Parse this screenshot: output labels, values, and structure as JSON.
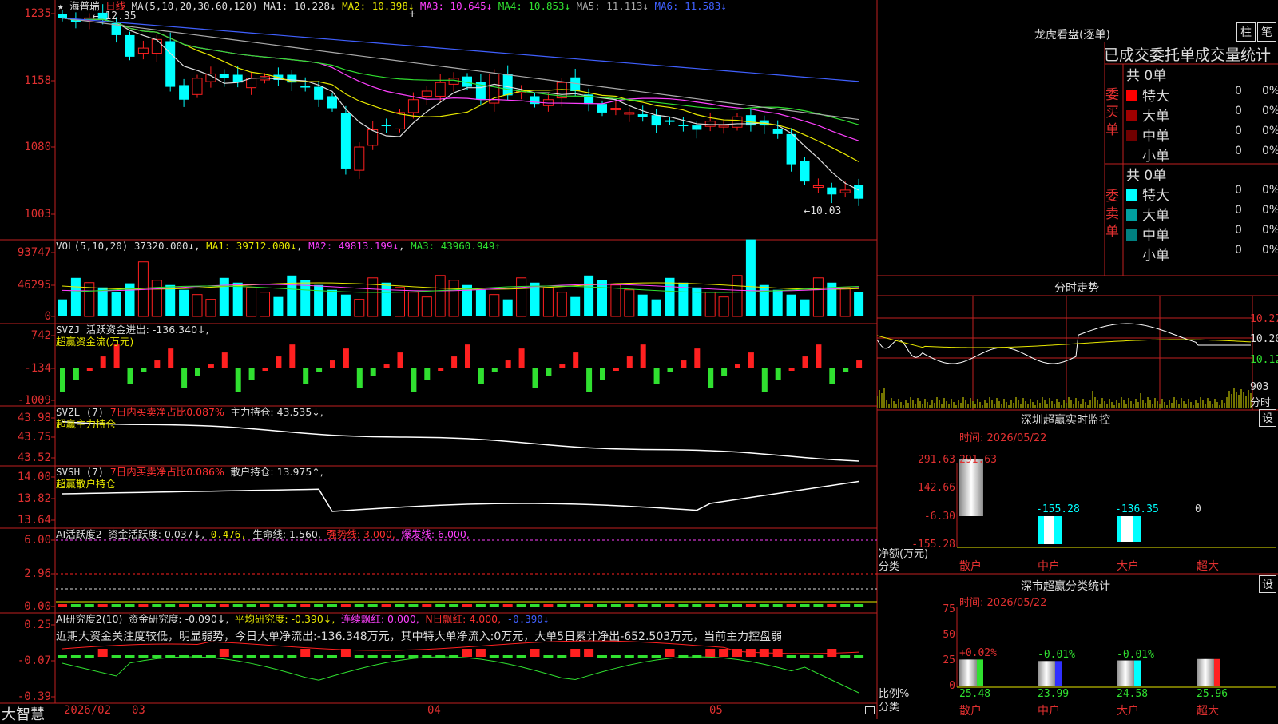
{
  "stock": {
    "name": "海普瑞",
    "period": "日线",
    "ma_label": "MA(5,10,20,30,60,120)",
    "ma": [
      {
        "label": "MA1:",
        "value": "10.228↓",
        "color": "#dddddd"
      },
      {
        "label": "MA2:",
        "value": "10.398↓",
        "color": "#e8e800"
      },
      {
        "label": "MA3:",
        "value": "10.645↓",
        "color": "#ff40ff"
      },
      {
        "label": "MA4:",
        "value": "10.853↓",
        "color": "#30e030"
      },
      {
        "label": "MA5:",
        "value": "11.113↓",
        "color": "#aaaaaa"
      },
      {
        "label": "MA6:",
        "value": "11.583↓",
        "color": "#4060ff"
      }
    ],
    "high_mark": "12.35",
    "low_mark": "10.03",
    "axis": [
      "1235",
      "1158",
      "1080",
      "1003"
    ]
  },
  "vol": {
    "label": "VOL(5,10,20)",
    "value": "37320.000↓",
    "ma1": "MA1: 39712.000↓",
    "ma2": "MA2: 49813.199↓",
    "ma3": "MA3: 43960.949↑",
    "axis": [
      "93747",
      "46295",
      "0"
    ]
  },
  "svzj": {
    "label": "SVZJ",
    "text": "活跃资金进出: -136.340↓,",
    "sub": "超赢资金流(万元)",
    "axis": [
      "742",
      "-134",
      "-1009"
    ]
  },
  "svzl": {
    "label": "SVZL (7)",
    "text1": "7日内买卖净占比0.087%",
    "text2": "主力持仓: 43.535↓,",
    "sub": "超赢主力持仓",
    "axis": [
      "43.98",
      "43.75",
      "43.52"
    ]
  },
  "svsh": {
    "label": "SVSH (7)",
    "text1": "7日内买卖净占比0.086%",
    "text2": "散户持仓: 13.975↑,",
    "sub": "超赢散户持仓",
    "axis": [
      "14.00",
      "13.82",
      "13.64"
    ]
  },
  "ai1": {
    "label": "AI活跃度2",
    "t1": "资金活跃度: 0.037↓,",
    "t2": "0.476,",
    "t3": "生命线: 1.560,",
    "t4": "强势线: 3.000,",
    "t5": "爆发线: 6.000,",
    "axis": [
      "6.00",
      "2.96",
      "0.00"
    ]
  },
  "ai2": {
    "label": "AI研究度2(10)",
    "t1": "资金研究度: -0.090↓,",
    "t2": "平均研究度: -0.390↓,",
    "t3": "连续飘红: 0.000,",
    "t4": "N日飘红: 4.000,",
    "t5": "-0.390↓",
    "comment": "近期大资金关注度较低，明显弱势，今日大单净流出:-136.348万元，其中特大单净流入:0万元，大单5日累计净出-652.503万元，当前主力控盘弱",
    "axis": [
      "0.25",
      "-0.07",
      "-0.39"
    ]
  },
  "bottom": {
    "brand": "大智慧",
    "date_start": "2026/02",
    "months": [
      "03",
      "04",
      "05"
    ]
  },
  "right": {
    "title": "龙虎看盘(逐单)",
    "btn1": "柱",
    "btn2": "笔",
    "table_title": "已成交委托单成交量统计",
    "buy_label": "委买单",
    "sell_label": "委卖单",
    "buy_total": "共 0单",
    "sell_total": "共 0单",
    "buy_rows": [
      {
        "name": "特大",
        "value": "0",
        "pct": "0%",
        "color": "#ff0000"
      },
      {
        "name": "大单",
        "value": "0",
        "pct": "0%",
        "color": "#a00000"
      },
      {
        "name": "中单",
        "value": "0",
        "pct": "0%",
        "color": "#700000"
      },
      {
        "name": "小单",
        "value": "0",
        "pct": "0%",
        "color": "#000000"
      }
    ],
    "sell_rows": [
      {
        "name": "特大",
        "value": "0",
        "pct": "0%",
        "color": "#00ffff"
      },
      {
        "name": "大单",
        "value": "0",
        "pct": "0%",
        "color": "#00a0a0"
      },
      {
        "name": "中单",
        "value": "0",
        "pct": "0%",
        "color": "#008080"
      },
      {
        "name": "小单",
        "value": "0",
        "pct": "0%",
        "color": "#000000"
      }
    ],
    "intraday_title": "分时走势",
    "intraday_axis": [
      "10.27",
      "10.20",
      "10.12"
    ],
    "intraday_vol": "903",
    "intraday_tag": "分时",
    "monitor_title": "深圳超赢实时监控",
    "settings": "设",
    "monitor_date": "时间: 2026/05/22",
    "monitor_axis": [
      "291.63",
      "142.66",
      "-6.30",
      "-155.28"
    ],
    "monitor_bars": [
      {
        "label": "散户",
        "value": "291.63"
      },
      {
        "label": "中户",
        "value": "-155.28"
      },
      {
        "label": "大户",
        "value": "-136.35"
      },
      {
        "label": "超大",
        "value": "0"
      }
    ],
    "monitor_unit": "净额(万元)",
    "monitor_cat": "分类",
    "class_title": "深市超赢分类统计",
    "class_date": "时间: 2026/05/22",
    "class_axis": [
      "75",
      "50",
      "25",
      "0"
    ],
    "class_bars": [
      {
        "label": "散户",
        "change": "+0.02%",
        "value": "25.48",
        "color": "#30e030",
        "pct": 25.48
      },
      {
        "label": "中户",
        "change": "-0.01%",
        "value": "23.99",
        "color": "#3030ff",
        "pct": 23.99
      },
      {
        "label": "大户",
        "change": "-0.01%",
        "value": "24.58",
        "color": "#00ffff",
        "pct": 24.58
      },
      {
        "label": "超大",
        "change": "",
        "value": "25.96",
        "color": "#ff2020",
        "pct": 25.96
      }
    ],
    "class_unit": "比例%",
    "class_cat": "分类"
  }
}
